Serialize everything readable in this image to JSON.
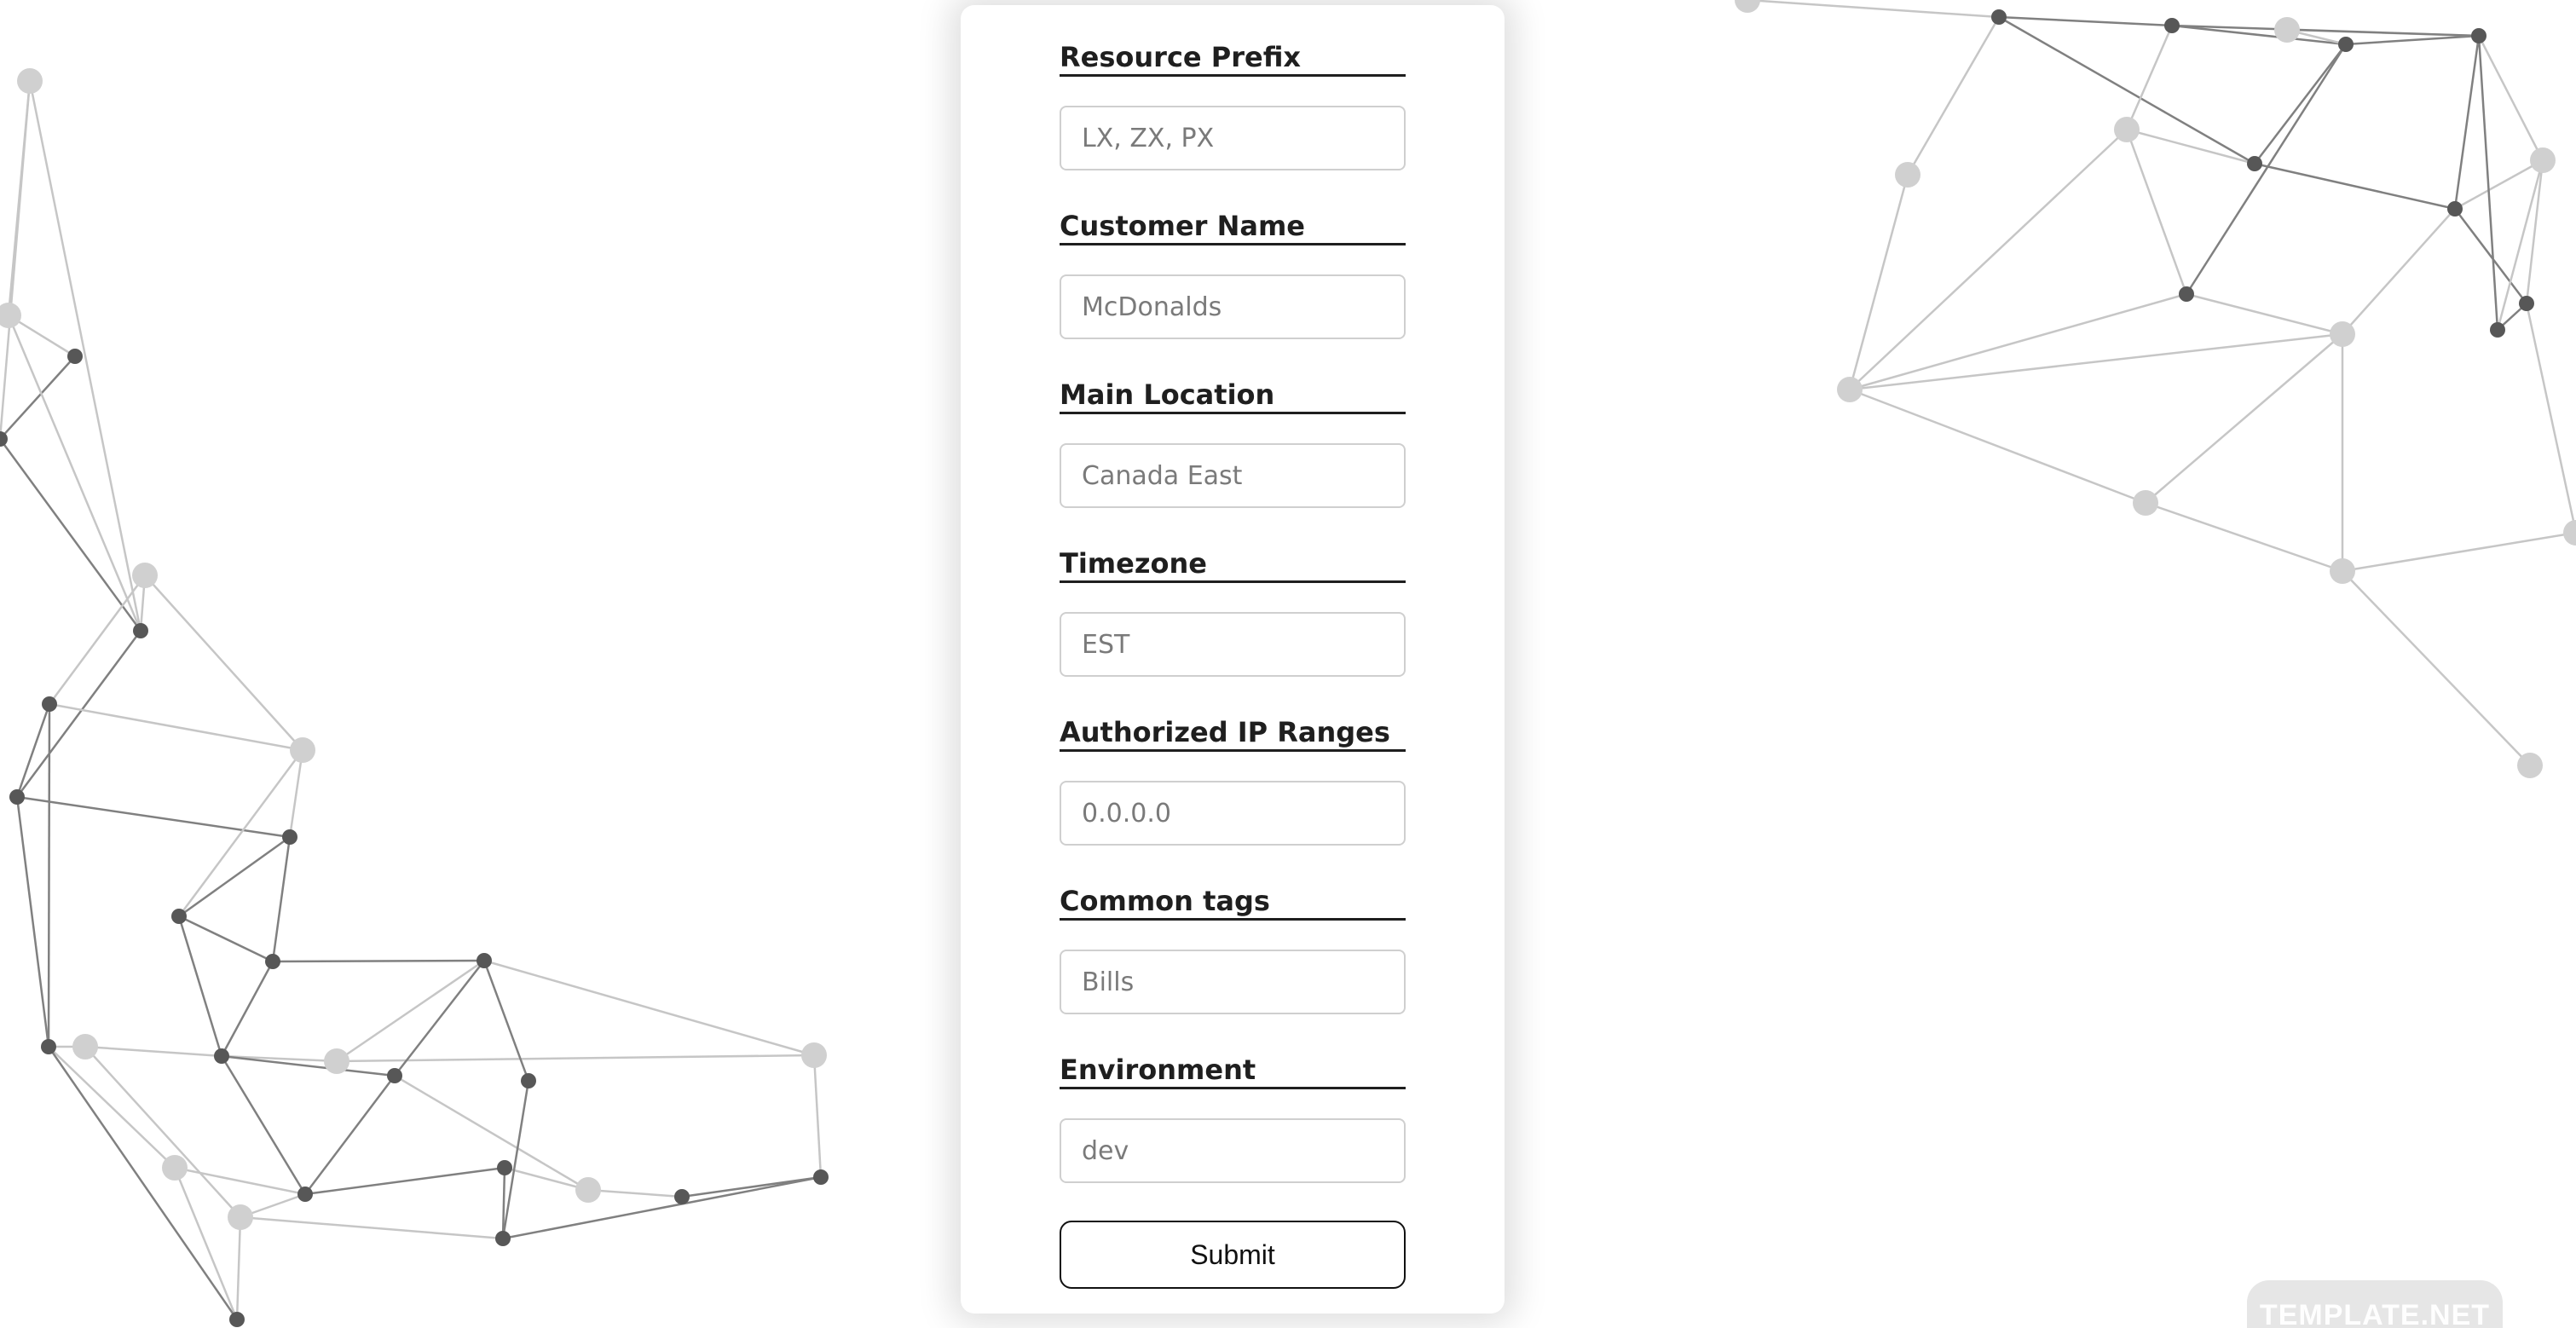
{
  "form": {
    "fields": [
      {
        "label": "Resource Prefix",
        "placeholder": "LX, ZX, PX"
      },
      {
        "label": "Customer Name",
        "placeholder": "McDonalds"
      },
      {
        "label": "Main Location",
        "placeholder": "Canada East"
      },
      {
        "label": "Timezone",
        "placeholder": "EST"
      },
      {
        "label": "Authorized IP Ranges",
        "placeholder": "0.0.0.0"
      },
      {
        "label": "Common tags",
        "placeholder": "Bills"
      },
      {
        "label": "Environment",
        "placeholder": "dev"
      }
    ],
    "submit_label": "Submit"
  },
  "watermark": {
    "text": "TEMPLATE.NET"
  },
  "colors": {
    "accent": "#1f1f1f",
    "input_border": "#cfcfcf",
    "network_dark": "#3a3a3a",
    "network_light": "#c8c8c8"
  }
}
